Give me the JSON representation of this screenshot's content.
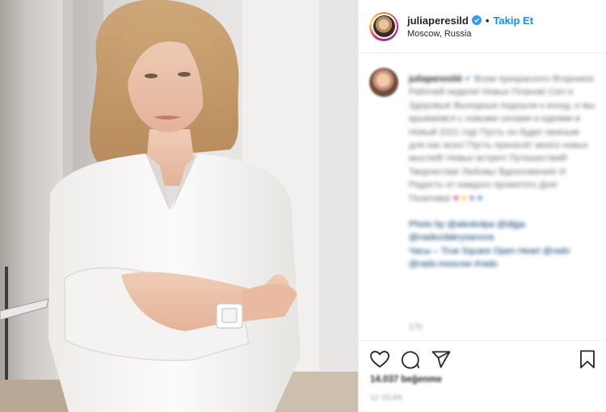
{
  "post": {
    "image_alt": "Portrait of woman in white shirt with arms crossed wearing a white watch",
    "author": {
      "username": "juliaperesild",
      "verified": true,
      "follow_label": "Takip Et",
      "separator": "•",
      "location": "Moscow, Russia",
      "avatar_icon": "profile-avatar-icon"
    },
    "caption": {
      "username": "juliaperesild",
      "text": "Всем прекрасного Вторника! Рабочей недели! Новых Планов! Сил и Здоровья! Выходные подошли к концу, и мы врываемся с новыми силами и идеями в Новый 2021 год! Пусть он будет нежным для нас всех! Пусть принесёт много новых мыслей! Новых встреч! Путешествий! Творчества! Любовь! Вдохновения! И Радость от каждого прожитого Дня! Позитива!",
      "credits_line1": "Photo by @alexkolpa @dijga @nadezdakrysanova",
      "credits_line2": "Часы – True Square Open Heart @rado @rado.moscow #rado",
      "time_ago": "17h"
    },
    "stats": {
      "likes_text": "14.037 beğenme",
      "date_text": "12 OCAK"
    },
    "colors": {
      "accent": "#0095f6",
      "verified": "#3897f0",
      "text": "#262626",
      "muted": "#8e8e8e"
    }
  }
}
